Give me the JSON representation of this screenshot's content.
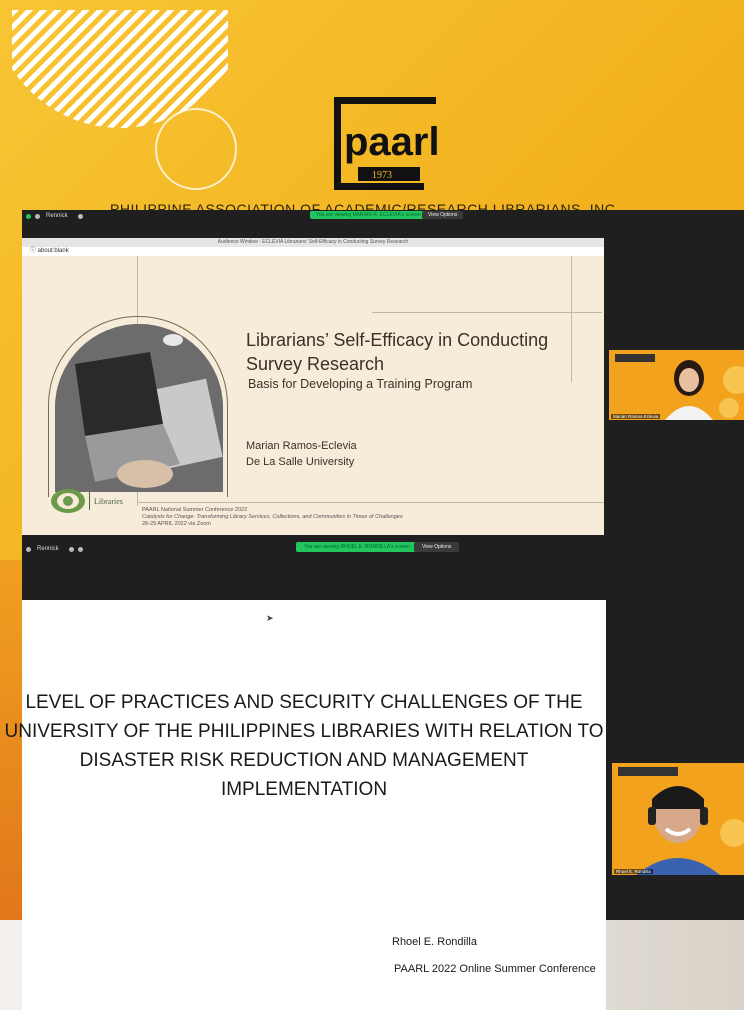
{
  "header": {
    "logo_text": "paarl",
    "logo_year": "1973",
    "org_name": "PHILIPPINE ASSOCIATION OF ACADEMIC/RESEARCH LIBRARIANS, INC."
  },
  "zoom_window_1": {
    "tab_label": "Rennick",
    "sharing_notice": "You are viewing MARIAN R. ECLEVIA's screen",
    "view_options": "View Options",
    "browser_title": "Audience Window - ECLEVIA Librarians' Self-Efficacy in Conducting Survey Research",
    "url": "about:blank",
    "slide": {
      "title": "Librarians’ Self-Efficacy in Conducting Survey Research",
      "subtitle": "Basis for Developing a Training Program",
      "author": "Marian Ramos-Eclevia",
      "affiliation": "De La Salle University",
      "library_label": "Libraries",
      "footer_line1": "PAARL National Summer Conference 2022",
      "footer_line2": "Catalysts for Change: Transforming Library Services, Collections, and Communities in Times of Challenges",
      "footer_line3": "28-29 APRIL 2022 via Zoom"
    },
    "participant_label": "Marian Ramos-Eclevia"
  },
  "zoom_window_2": {
    "tab_label": "Rennick",
    "sharing_notice": "You are viewing RHOEL E. RONDILLA's screen",
    "view_options": "View Options",
    "slide": {
      "title": "LEVEL OF PRACTICES AND SECURITY CHALLENGES OF THE UNIVERSITY OF THE PHILIPPINES LIBRARIES WITH RELATION TO DISASTER RISK REDUCTION AND MANAGEMENT IMPLEMENTATION",
      "presenter": "Rhoel E. Rondilla",
      "conference": "PAARL 2022 Online Summer Conference"
    },
    "participant_label": "Rhoel E. Rondilla"
  },
  "colors": {
    "background": "#f4b827",
    "zoom_dark": "#1f1f1f",
    "sharing_green": "#22c55e",
    "slide1_bg": "#f7ebd9"
  }
}
